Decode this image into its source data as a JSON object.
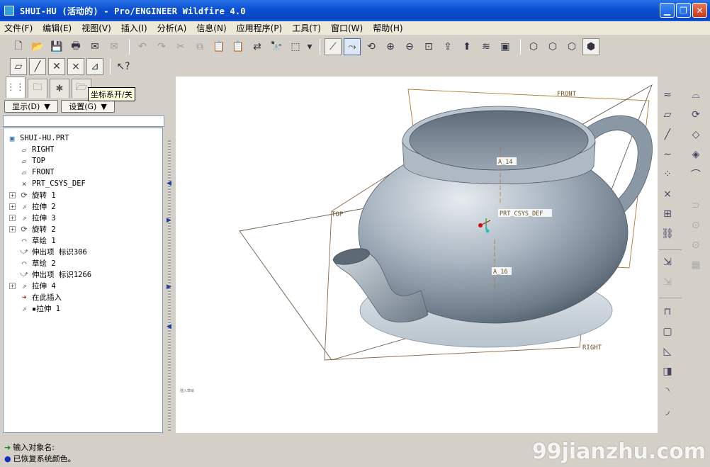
{
  "window": {
    "title": "SHUI-HU (活动的) - Pro/ENGINEER Wildfire 4.0"
  },
  "menu": [
    "文件(F)",
    "编辑(E)",
    "视图(V)",
    "插入(I)",
    "分析(A)",
    "信息(N)",
    "应用程序(P)",
    "工具(T)",
    "窗口(W)",
    "帮助(H)"
  ],
  "panel": {
    "tooltip": "坐标系开/关",
    "show_btn": "显示(D)",
    "settings_btn": "设置(G)"
  },
  "tree": {
    "root": "SHUI-HU.PRT",
    "items": [
      {
        "label": "RIGHT",
        "icon": "datum-plane-icon",
        "expandable": false
      },
      {
        "label": "TOP",
        "icon": "datum-plane-icon",
        "expandable": false
      },
      {
        "label": "FRONT",
        "icon": "datum-plane-icon",
        "expandable": false
      },
      {
        "label": "PRT_CSYS_DEF",
        "icon": "csys-icon",
        "expandable": false
      },
      {
        "label": "旋转 1",
        "icon": "revolve-icon",
        "expandable": true
      },
      {
        "label": "拉伸 2",
        "icon": "extrude-icon",
        "expandable": true
      },
      {
        "label": "拉伸 3",
        "icon": "extrude-icon",
        "expandable": true
      },
      {
        "label": "旋转 2",
        "icon": "revolve-icon",
        "expandable": true
      },
      {
        "label": "草绘 1",
        "icon": "sketch-icon",
        "expandable": false
      },
      {
        "label": "伸出项 标识306",
        "icon": "protrusion-icon",
        "expandable": false
      },
      {
        "label": "草绘 2",
        "icon": "sketch-icon",
        "expandable": false
      },
      {
        "label": "伸出项 标识1266",
        "icon": "protrusion-icon",
        "expandable": false
      },
      {
        "label": "拉伸 4",
        "icon": "extrude-icon",
        "expandable": true
      },
      {
        "label": "在此插入",
        "icon": "insert-here-icon",
        "expandable": false
      },
      {
        "label": "▪拉伸 1",
        "icon": "extrude-icon",
        "expandable": false
      }
    ]
  },
  "viewport": {
    "labels": {
      "front": "FRONT",
      "top": "TOP",
      "right": "RIGHT",
      "a14": "A_14",
      "a16": "A_16",
      "csys": "PRT_CSYS_DEF"
    },
    "corner_text": "插入草绘"
  },
  "messages": [
    "输入对象名:",
    "已恢复系统颜色。"
  ],
  "watermark": "99jianzhu.com",
  "colors": {
    "titlebar": "#0a46c4",
    "datum": "#b07a30",
    "model": "#a8b4c0"
  }
}
